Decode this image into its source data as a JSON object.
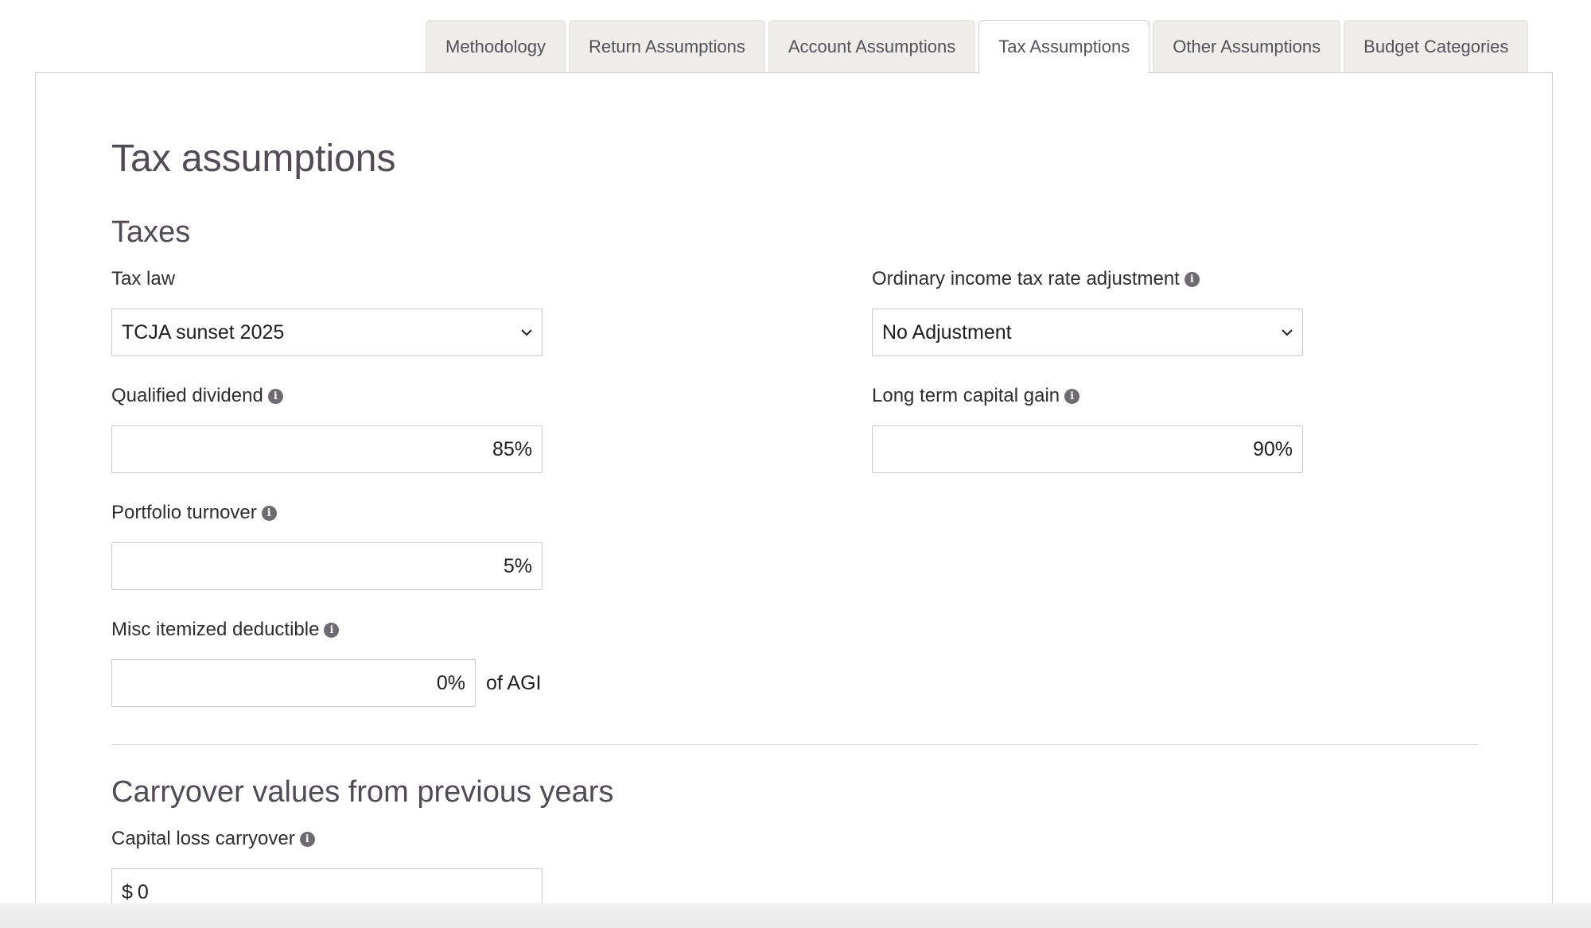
{
  "tabs": [
    {
      "label": "Methodology",
      "active": false
    },
    {
      "label": "Return Assumptions",
      "active": false
    },
    {
      "label": "Account Assumptions",
      "active": false
    },
    {
      "label": "Tax Assumptions",
      "active": true
    },
    {
      "label": "Other Assumptions",
      "active": false
    },
    {
      "label": "Budget Categories",
      "active": false
    }
  ],
  "page": {
    "title": "Tax assumptions",
    "section_taxes": "Taxes",
    "section_carryover": "Carryover values from previous years"
  },
  "fields": {
    "tax_law": {
      "label": "Tax law",
      "value": "TCJA sunset 2025"
    },
    "ordinary_income": {
      "label": "Ordinary income tax rate adjustment",
      "value": "No Adjustment"
    },
    "qualified_dividend": {
      "label": "Qualified dividend",
      "value": "85%"
    },
    "long_term_capital_gain": {
      "label": "Long term capital gain",
      "value": "90%"
    },
    "portfolio_turnover": {
      "label": "Portfolio turnover",
      "value": "5%"
    },
    "misc_itemized": {
      "label": "Misc itemized deductible",
      "value": "0%",
      "suffix": "of AGI"
    },
    "capital_loss_carryover": {
      "label": "Capital loss carryover",
      "currency": "$",
      "value": "0"
    }
  },
  "icons": {
    "info": "i"
  },
  "colors": {
    "heading": "#514b55",
    "tab_bg": "#eeedea",
    "info_icon": "#6e6b70"
  }
}
